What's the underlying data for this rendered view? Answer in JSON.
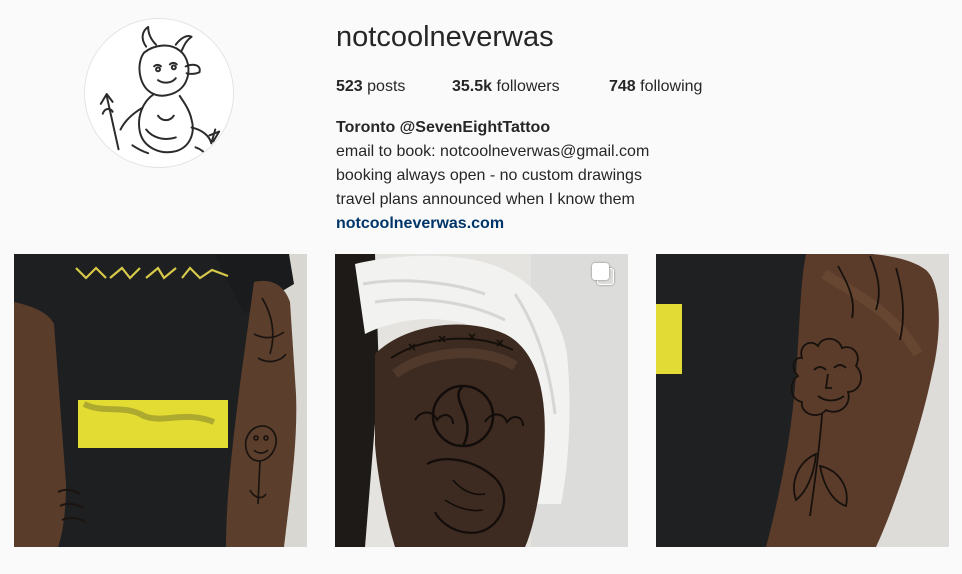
{
  "profile": {
    "username": "notcoolneverwas",
    "avatar_icon": "devil-drawing-avatar"
  },
  "stats": {
    "posts_count": "523",
    "posts_label": "posts",
    "followers_count": "35.5k",
    "followers_label": "followers",
    "following_count": "748",
    "following_label": "following"
  },
  "bio": {
    "name_line": "Toronto @SevenEightTattoo",
    "lines": [
      "email to book: notcoolneverwas@gmail.com",
      "booking always open - no custom drawings",
      "travel plans announced when I know them"
    ],
    "link": "notcoolneverwas.com"
  },
  "posts": [
    {
      "subject": "forearm-tattoo-photo",
      "multi": false
    },
    {
      "subject": "shoulder-tattoo-photo",
      "multi": true,
      "multi_icon": "carousel-icon"
    },
    {
      "subject": "forearm-flower-face-tattoo-photo",
      "multi": false
    }
  ],
  "colors": {
    "background": "#fafafa",
    "text": "#262626",
    "link": "#003569",
    "avatar_border": "#e2e2e2"
  }
}
